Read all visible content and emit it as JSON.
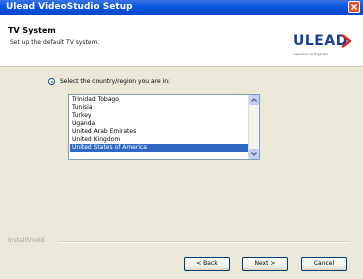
{
  "window": {
    "title": "Ulead VideoStudio Setup"
  },
  "header": {
    "title": "TV System",
    "subtitle": "Set up the default TV system.",
    "logo_text": "ULEAD",
    "logo_tagline": "inspiration at fingertips"
  },
  "content": {
    "radio_label": "Select the country/region you are in:",
    "countries": [
      "Trinidad Tobago",
      "Tunisia",
      "Turkey",
      "Uganda",
      "United Arab Emirates",
      "United Kingdom",
      "United States of America"
    ],
    "selected_country": "United States of America"
  },
  "footer": {
    "brand": "InstallShield",
    "back_label": "< Back",
    "next_label": "Next >",
    "cancel_label": "Cancel"
  },
  "colors": {
    "titlebar": "#0a56dd",
    "selection": "#316ac5",
    "logo": "#1a3d9a"
  }
}
